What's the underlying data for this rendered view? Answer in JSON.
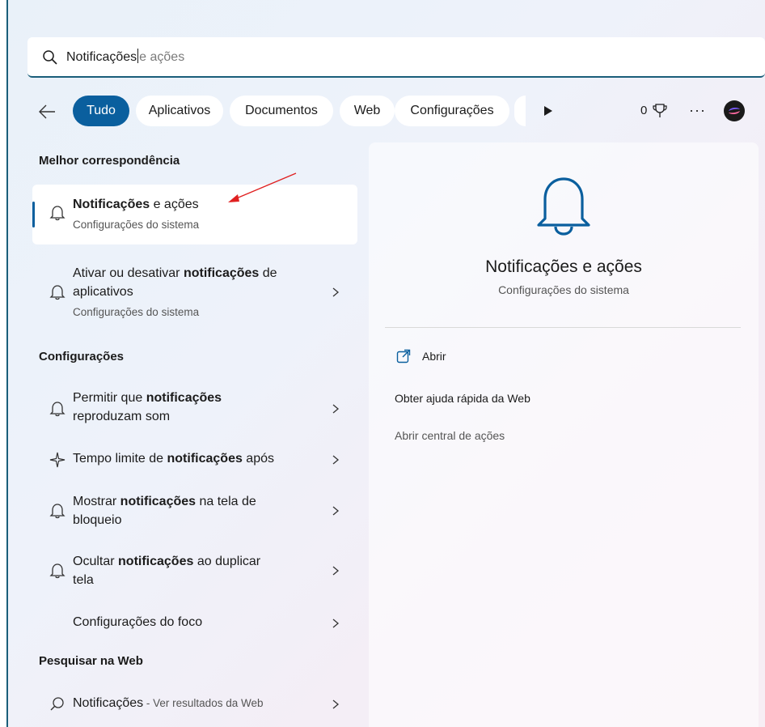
{
  "search": {
    "typed": "Notificações",
    "suggestion": "e ações"
  },
  "filters": {
    "chips": [
      {
        "label": "Tudo",
        "active": true
      },
      {
        "label": "Aplicativos",
        "active": false
      },
      {
        "label": "Documentos",
        "active": false
      },
      {
        "label": "Web",
        "active": false
      },
      {
        "label": "Configurações",
        "active": false
      }
    ],
    "points": "0"
  },
  "best_match": {
    "heading": "Melhor correspondência",
    "title_bold": "Notificações",
    "title_rest": " e ações",
    "subtitle": "Configurações do sistema"
  },
  "best_match_2": {
    "title_pre": "Ativar ou desativar ",
    "title_bold": "notificações",
    "title_post": " de aplicativos",
    "subtitle": "Configurações do sistema"
  },
  "settings": {
    "heading": "Configurações",
    "items": [
      {
        "pre": "Permitir que ",
        "bold": "notificações",
        "post": " reproduzam som",
        "icon": "bell-icon"
      },
      {
        "pre": "Tempo limite de ",
        "bold": "notificações",
        "post": " após",
        "icon": "sparkle-icon"
      },
      {
        "pre": "Mostrar ",
        "bold": "notificações",
        "post": " na tela de bloqueio",
        "icon": "bell-icon"
      },
      {
        "pre": "Ocultar ",
        "bold": "notificações",
        "post": " ao duplicar tela",
        "icon": "bell-icon"
      },
      {
        "pre": "Configurações do foco",
        "bold": "",
        "post": "",
        "icon": ""
      }
    ]
  },
  "web": {
    "heading": "Pesquisar na Web",
    "item_bold": "Notificações",
    "item_rest": " - Ver resultados da Web"
  },
  "detail": {
    "title": "Notificações e ações",
    "subtitle": "Configurações do sistema",
    "actions": [
      "Abrir",
      "Obter ajuda rápida da Web",
      "Abrir central de ações"
    ]
  },
  "colors": {
    "accent": "#0a5f9e",
    "annotation_arrow": "#e02020"
  }
}
